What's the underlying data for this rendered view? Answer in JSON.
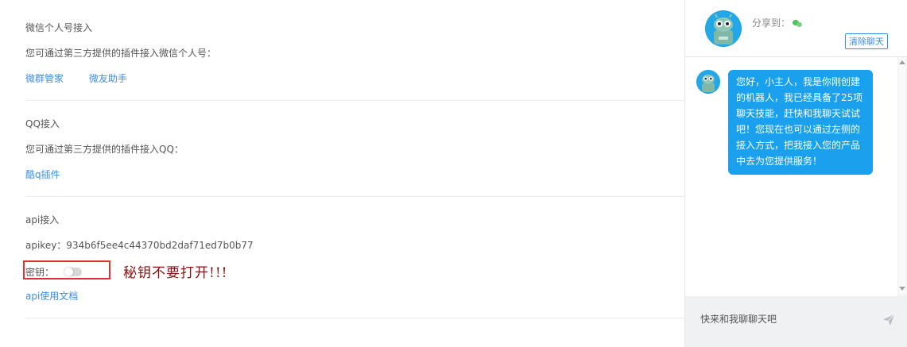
{
  "sections": {
    "wechat": {
      "title": "微信个人号接入",
      "desc": "您可通过第三方提供的插件接入微信个人号：",
      "links": [
        "微群管家",
        "微友助手"
      ]
    },
    "qq": {
      "title": "QQ接入",
      "desc": "您可通过第三方提供的插件接入QQ：",
      "links": [
        "酷q插件"
      ]
    },
    "api": {
      "title": "api接入",
      "apikey_label": "apikey：934b6f5ee4c44370bd2daf71ed7b0b77",
      "secret_label": "密钥：",
      "secret_enabled": false,
      "doc_link": "api使用文档"
    }
  },
  "annotation": {
    "warning_text": "秘钥不要打开!!!",
    "box_color": "#e03030",
    "text_color": "#8b1010"
  },
  "chat": {
    "share_label": "分享到：",
    "share_icon": "wechat-icon",
    "clear_button": "清除聊天",
    "bot_avatar_icon": "robot-avatar-icon",
    "messages": [
      {
        "sender": "bot",
        "text": "您好，小主人，我是你刚创建的机器人，我已经具备了25项聊天技能，赶快和我聊天试试吧！您现在也可以通过左侧的接入方式，把我接入您的产品中去为您提供服务！"
      }
    ],
    "input_placeholder": "快来和我聊聊天吧",
    "send_icon": "send-icon",
    "bubble_color": "#1aa0ec",
    "accent": "#3a8ee6"
  }
}
